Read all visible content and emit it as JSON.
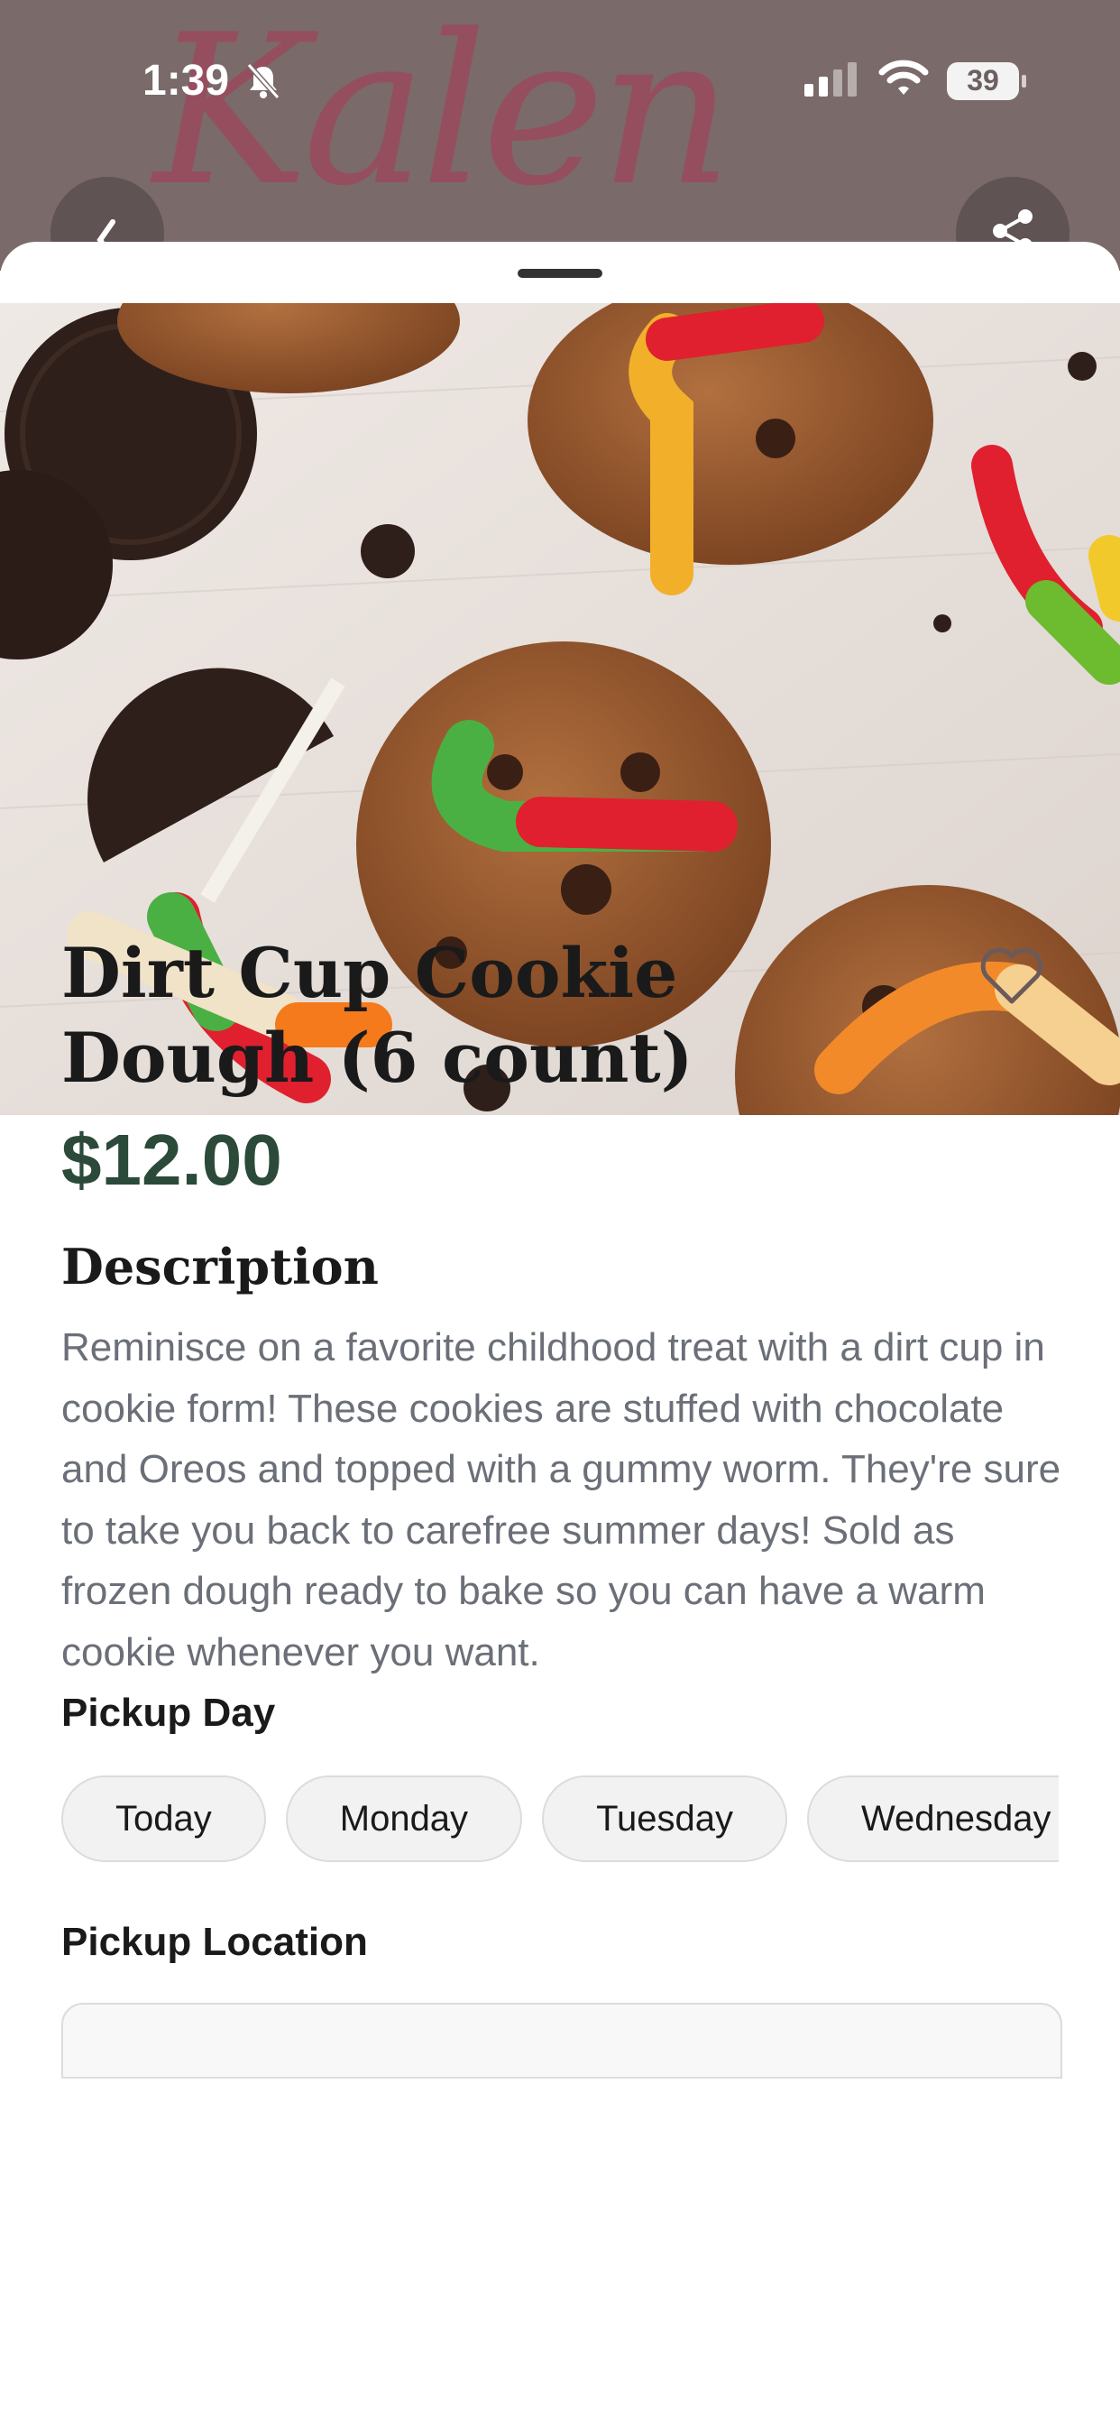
{
  "status": {
    "time": "1:39",
    "battery": "39"
  },
  "header": {
    "logo_text": "Kalen"
  },
  "product": {
    "title": "Dirt Cup Cookie Dough (6 count)",
    "price": "$12.00",
    "description_heading": "Description",
    "description": "Reminisce on a favorite childhood treat with a dirt cup in cookie form! These cookies are stuffed with chocolate and Oreos and topped with a gummy worm. They're sure to take you back to carefree summer days! Sold as frozen dough ready to bake so you can have a warm cookie whenever you want."
  },
  "pickup": {
    "day_label": "Pickup Day",
    "days": [
      "Today",
      "Monday",
      "Tuesday",
      "Wednesday"
    ],
    "location_label": "Pickup Location"
  },
  "colors": {
    "price": "#2c4a3a",
    "header_bg": "#7a6a6a",
    "logo": "#9a4a5c"
  }
}
